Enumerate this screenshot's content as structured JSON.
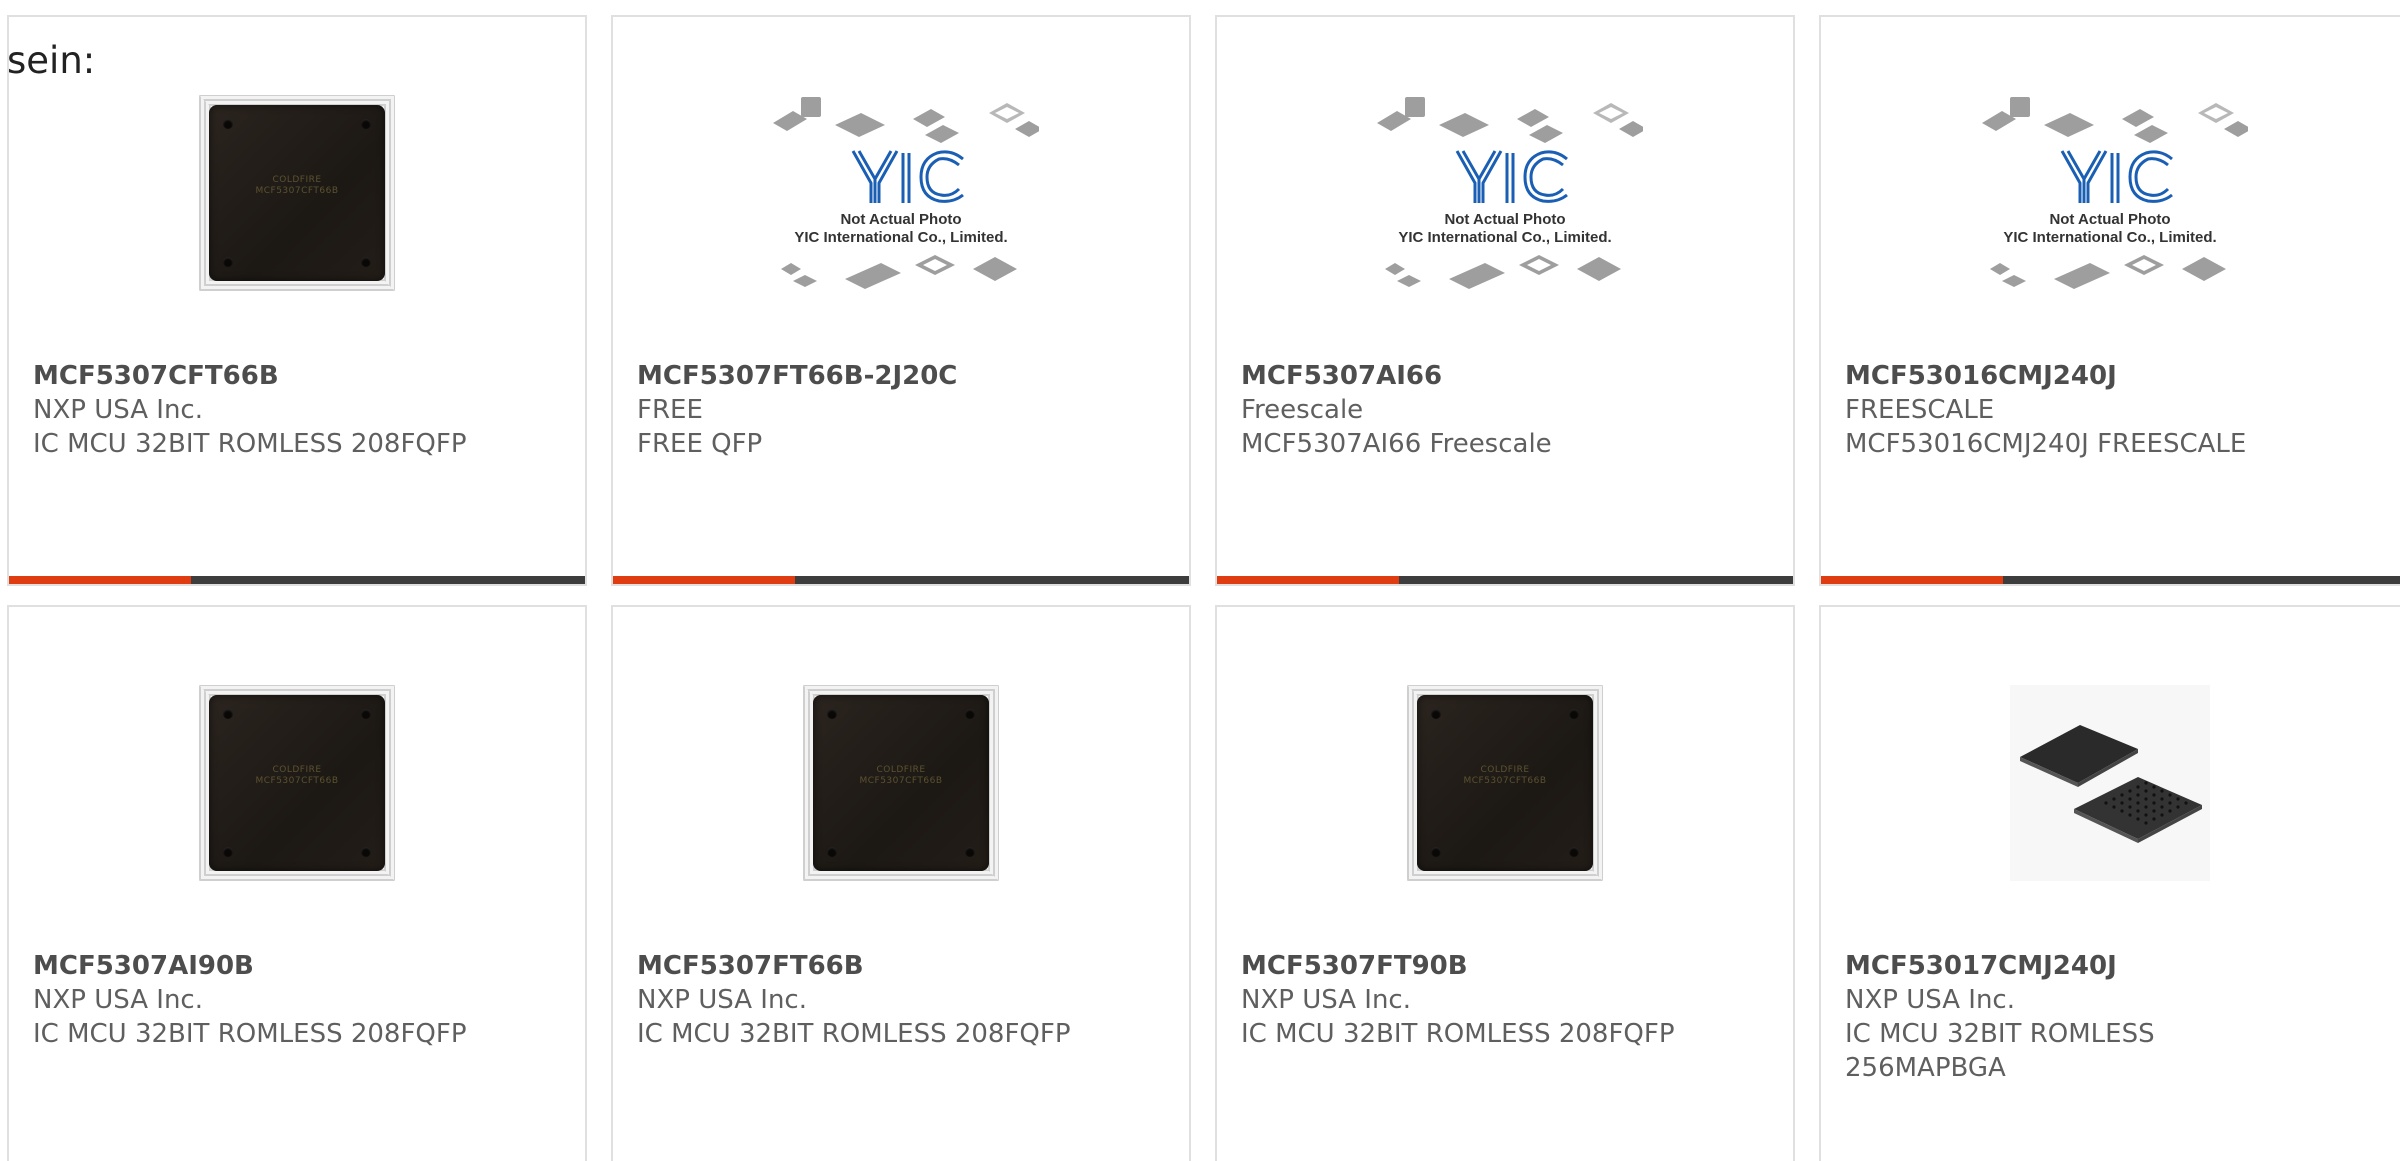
{
  "intro_text": "sein:",
  "colors": {
    "accent": "#e03c12",
    "bar": "#3d3d3d",
    "border": "#e0e0e0"
  },
  "placeholder": {
    "brand": "YIC",
    "line1": "Not Actual Photo",
    "line2": "YIC International Co., Limited."
  },
  "chip_marking": {
    "line1": "COLDFIRE",
    "line2": "MCF5307CFT66B"
  },
  "products": [
    {
      "part": "MCF5307CFT66B",
      "maker": "NXP USA Inc.",
      "desc": "IC MCU 32BIT ROMLESS 208FQFP",
      "image": "qfp-chip"
    },
    {
      "part": "MCF5307FT66B-2J20C",
      "maker": "FREE",
      "desc": "FREE QFP",
      "image": "yic-placeholder"
    },
    {
      "part": "MCF5307AI66",
      "maker": "Freescale",
      "desc": "MCF5307AI66 Freescale",
      "image": "yic-placeholder"
    },
    {
      "part": "MCF53016CMJ240J",
      "maker": "FREESCALE",
      "desc": "MCF53016CMJ240J FREESCALE",
      "image": "yic-placeholder"
    },
    {
      "part": "MCF5307AI90B",
      "maker": "NXP USA Inc.",
      "desc": "IC MCU 32BIT ROMLESS 208FQFP",
      "image": "qfp-chip"
    },
    {
      "part": "MCF5307FT66B",
      "maker": "NXP USA Inc.",
      "desc": "IC MCU 32BIT ROMLESS 208FQFP",
      "image": "qfp-chip"
    },
    {
      "part": "MCF5307FT90B",
      "maker": "NXP USA Inc.",
      "desc": "IC MCU 32BIT ROMLESS 208FQFP",
      "image": "qfp-chip"
    },
    {
      "part": "MCF53017CMJ240J",
      "maker": "NXP USA Inc.",
      "desc": "IC MCU 32BIT ROMLESS 256MAPBGA",
      "image": "bga-chip"
    }
  ]
}
